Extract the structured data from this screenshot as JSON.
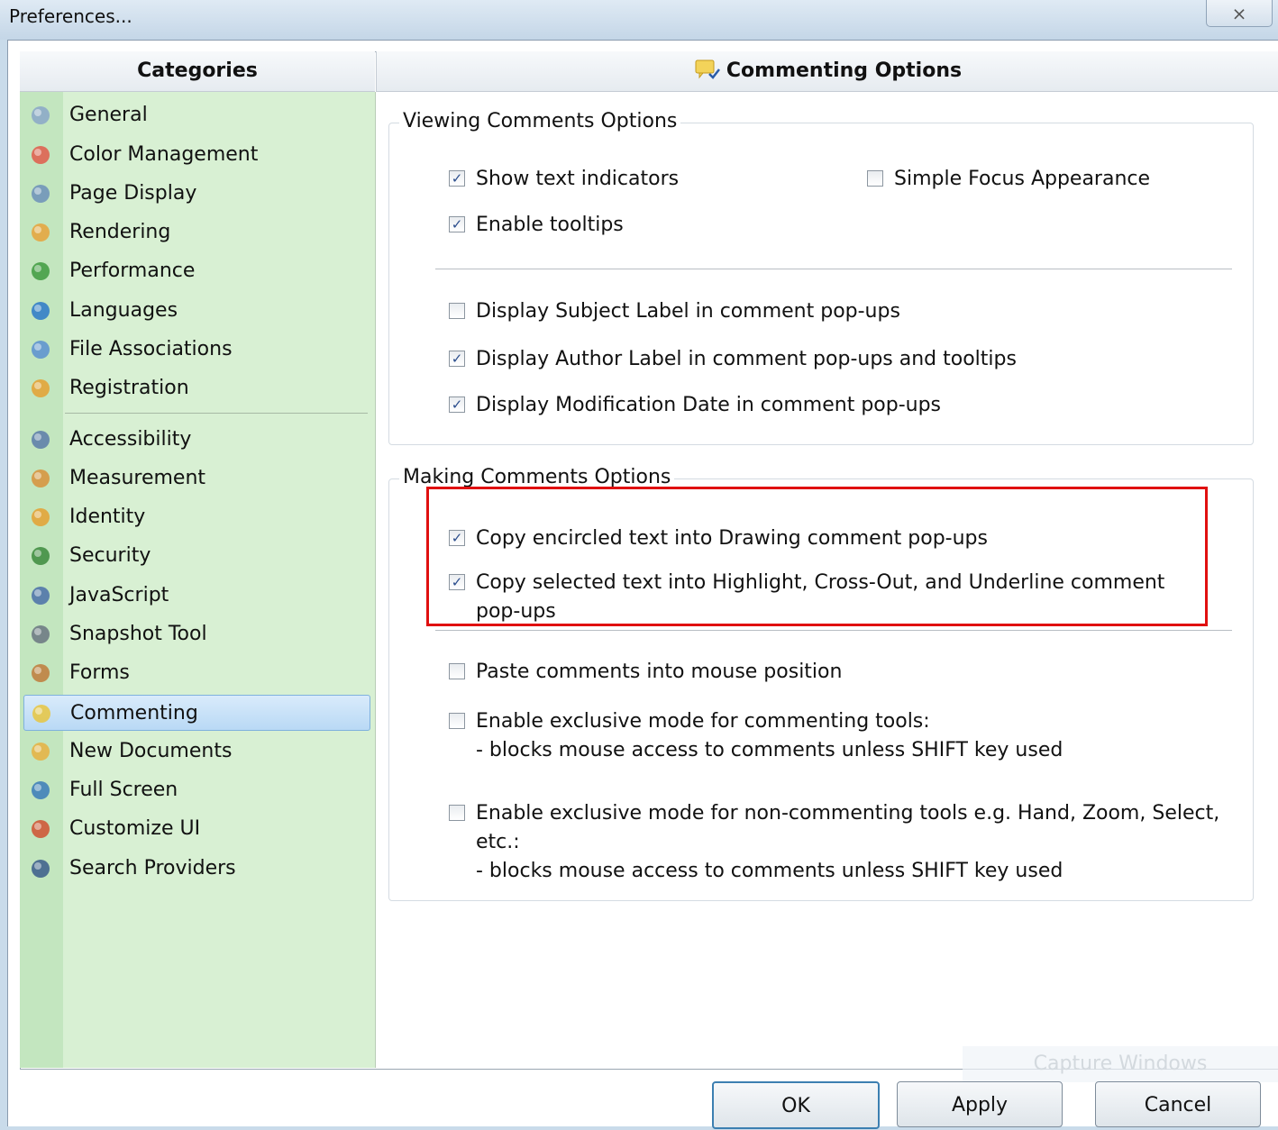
{
  "window": {
    "title": "Preferences...",
    "close_glyph": "⨯"
  },
  "categories_header": "Categories",
  "options_header": "Commenting Options",
  "categories": [
    {
      "label": "General",
      "icon": "gears-icon",
      "color": "#8aa6c8"
    },
    {
      "label": "Color Management",
      "icon": "color-balls-icon",
      "color": "#e05a4a"
    },
    {
      "label": "Page Display",
      "icon": "magnifier-page-icon",
      "color": "#6c8fb8"
    },
    {
      "label": "Rendering",
      "icon": "brush-icon",
      "color": "#e7a23a"
    },
    {
      "label": "Performance",
      "icon": "chart-icon",
      "color": "#3e9a3e"
    },
    {
      "label": "Languages",
      "icon": "globe-icon",
      "color": "#2c78c8"
    },
    {
      "label": "File Associations",
      "icon": "file-assoc-icon",
      "color": "#5a8fd0"
    },
    {
      "label": "Registration",
      "icon": "users-icon",
      "color": "#e5a030"
    },
    {
      "label": "Accessibility",
      "icon": "accessibility-icon",
      "color": "#5a7aa8"
    },
    {
      "label": "Measurement",
      "icon": "pencil-icon",
      "color": "#d8903a"
    },
    {
      "label": "Identity",
      "icon": "user-check-icon",
      "color": "#e5a030"
    },
    {
      "label": "Security",
      "icon": "shield-icon",
      "color": "#3c8a3c"
    },
    {
      "label": "JavaScript",
      "icon": "js-icon",
      "color": "#4a6fa8"
    },
    {
      "label": "Snapshot Tool",
      "icon": "camera-icon",
      "color": "#6a7480"
    },
    {
      "label": "Forms",
      "icon": "form-icon",
      "color": "#c07a3a"
    },
    {
      "label": "Commenting",
      "icon": "comment-icon",
      "color": "#e8c640"
    },
    {
      "label": "New Documents",
      "icon": "new-doc-icon",
      "color": "#e8b040"
    },
    {
      "label": "Full Screen",
      "icon": "fullscreen-icon",
      "color": "#3a7ab8"
    },
    {
      "label": "Customize UI",
      "icon": "paint-icon",
      "color": "#d05030"
    },
    {
      "label": "Search Providers",
      "icon": "search-provider-icon",
      "color": "#3a5a8a"
    }
  ],
  "selected_category": "Commenting",
  "viewing_group": {
    "legend": "Viewing Comments Options",
    "show_text_indicators": {
      "label": "Show text indicators",
      "checked": true
    },
    "simple_focus": {
      "label": "Simple Focus Appearance",
      "checked": false
    },
    "enable_tooltips": {
      "label": "Enable tooltips",
      "checked": true
    },
    "display_subject": {
      "label": "Display Subject Label in comment pop-ups",
      "checked": false
    },
    "display_author": {
      "label": "Display Author Label in comment pop-ups and tooltips",
      "checked": true
    },
    "display_mod_date": {
      "label": "Display Modification Date in comment pop-ups",
      "checked": true
    }
  },
  "making_group": {
    "legend": "Making Comments Options",
    "copy_encircled": {
      "label": "Copy encircled text into Drawing comment pop-ups",
      "checked": true
    },
    "copy_selected": {
      "label": "Copy selected text into Highlight, Cross-Out, and Underline comment",
      "label2": "pop-ups",
      "checked": true
    },
    "paste_mouse": {
      "label": "Paste comments into mouse position",
      "checked": false
    },
    "exclusive_commenting": {
      "label": "Enable exclusive mode for commenting tools:",
      "sub": "- blocks mouse access to comments unless SHIFT key used",
      "checked": false
    },
    "exclusive_noncommenting": {
      "label": "Enable exclusive mode for non-commenting tools e.g. Hand, Zoom, Select,",
      "label2": "etc.:",
      "sub": "- blocks mouse access to comments unless SHIFT key used",
      "checked": false
    }
  },
  "watermark": "Capture Windows",
  "buttons": {
    "ok": "OK",
    "apply": "Apply",
    "cancel": "Cancel"
  },
  "check_glyph": "✓",
  "annotation_color": "#e01010"
}
